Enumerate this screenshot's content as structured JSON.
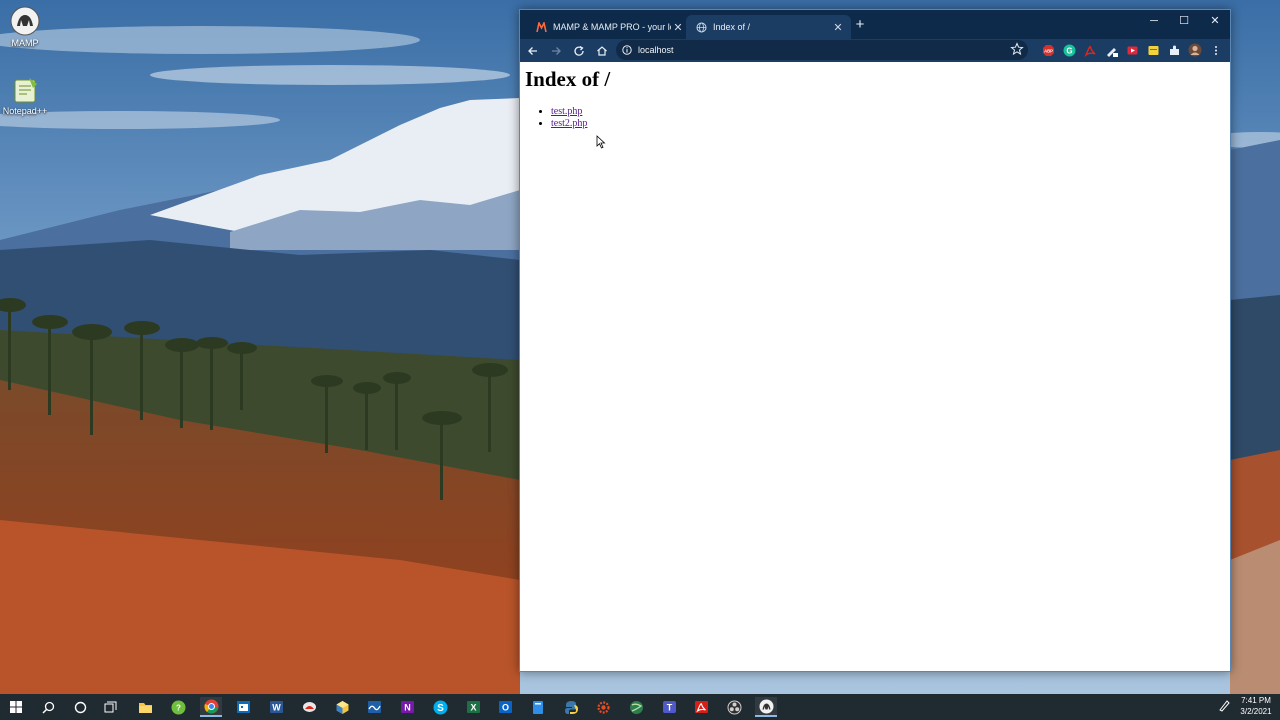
{
  "desktop": {
    "icons": [
      {
        "label": "MAMP"
      },
      {
        "label": "Notepad++"
      }
    ]
  },
  "browser": {
    "tabs": [
      {
        "title": "MAMP & MAMP PRO - your loc",
        "icon": "mamp-favicon",
        "active": false
      },
      {
        "title": "Index of /",
        "icon": "globe-icon",
        "active": true
      }
    ],
    "window_controls": {
      "minimize": "─",
      "maximize": "☐",
      "close": "✕"
    },
    "new_tab": "+",
    "address": {
      "value": "localhost",
      "icon": "info-icon"
    },
    "extensions": [
      "adblock-icon",
      "grammarly-icon",
      "acrobat-icon",
      "pen-icon",
      "video-icon",
      "note-icon",
      "puzzle-icon",
      "profile-avatar"
    ],
    "colors": {
      "frame": "#0e2a4a",
      "toolbar": "#1c3d63",
      "link_visited": "#551a8b"
    }
  },
  "page": {
    "heading": "Index of /",
    "links": [
      {
        "text": "test.php"
      },
      {
        "text": "test2.php"
      }
    ]
  },
  "taskbar": {
    "icons": [
      "windows-start-icon",
      "search-icon",
      "cortana-icon",
      "task-view-icon",
      "file-explorer-icon",
      "app-green-icon",
      "chrome-icon",
      "outlook-calendar-icon",
      "word-icon",
      "app-red-icon",
      "app-cube-icon",
      "app-wave-icon",
      "onenote-icon",
      "skype-icon",
      "excel-icon",
      "outlook-icon",
      "app-blue-icon",
      "python-icon",
      "settings-icon",
      "app-globe-icon",
      "teams-icon",
      "acrobat-icon",
      "obs-icon",
      "mamp-icon"
    ],
    "clock": {
      "time": "7:41 PM",
      "date": "3/2/2021"
    }
  }
}
